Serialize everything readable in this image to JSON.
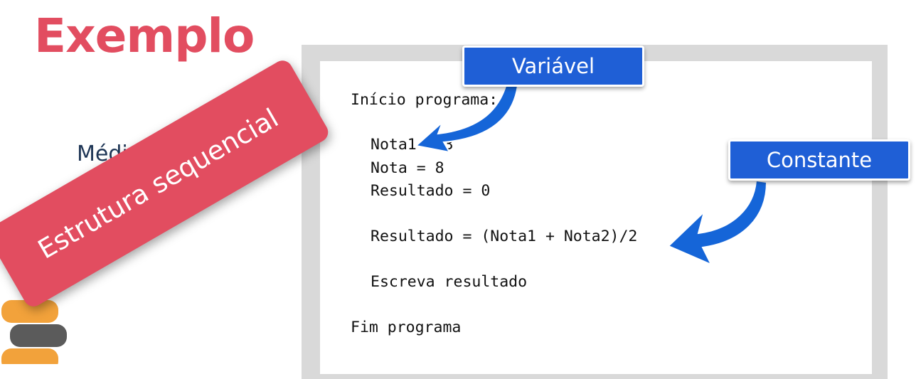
{
  "slide": {
    "title": "Exemplo",
    "subtitle": "Média escolar"
  },
  "code": {
    "lines": [
      "Início programa:",
      "Nota1 = 3",
      "Nota = 8",
      "Resultado = 0",
      "Resultado = (Nota1 + Nota2)/2",
      "Escreva resultado",
      "Fim programa"
    ]
  },
  "callouts": {
    "variable": "Variável",
    "constant": "Constante"
  },
  "banner": {
    "text": "Estrutura sequencial"
  },
  "colors": {
    "accent_red": "#e24d60",
    "callout_blue": "#1f5fd6",
    "arrow_blue": "#1565d8",
    "subtitle_navy": "#1f3656",
    "frame_gray": "#d9d9d9"
  }
}
